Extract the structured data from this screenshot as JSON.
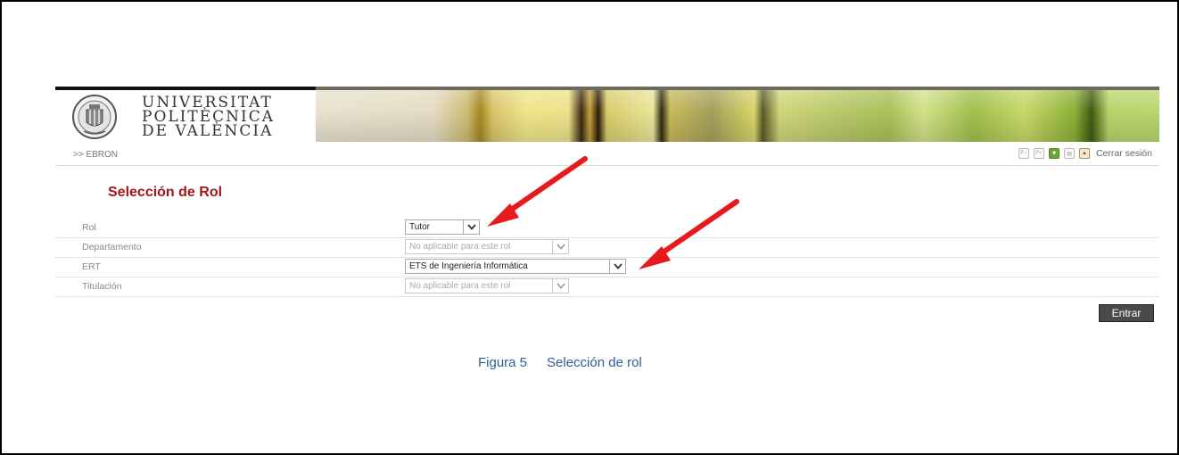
{
  "header": {
    "university_name_lines": [
      "UNIVERSITAT",
      "POLITÈCNICA",
      "DE VALÈNCIA"
    ],
    "logo_icon": "upv-seal-icon"
  },
  "breadcrumb": {
    "text": ">> EBRON"
  },
  "top_tools": {
    "icons": [
      "font-size-small-icon",
      "font-size-large-icon",
      "green-square-icon",
      "print-icon",
      "exit-icon"
    ],
    "logout_label": "Cerrar sesión"
  },
  "form": {
    "title": "Selección de Rol",
    "rows": [
      {
        "label": "Rol",
        "value": "Tutor",
        "enabled": true
      },
      {
        "label": "Departamento",
        "value": "No aplicable para este rol",
        "enabled": false
      },
      {
        "label": "ERT",
        "value": "ETS de Ingeniería Informática",
        "enabled": true
      },
      {
        "label": "Titulación",
        "value": "No aplicable para este rol",
        "enabled": false
      }
    ],
    "submit_label": "Entrar"
  },
  "caption": {
    "figure": "Figura 5",
    "text": "Selección de rol"
  },
  "colors": {
    "title": "#a3161b",
    "caption": "#2f5b95",
    "arrow": "#e8191d",
    "button": "#4a4a4a"
  }
}
